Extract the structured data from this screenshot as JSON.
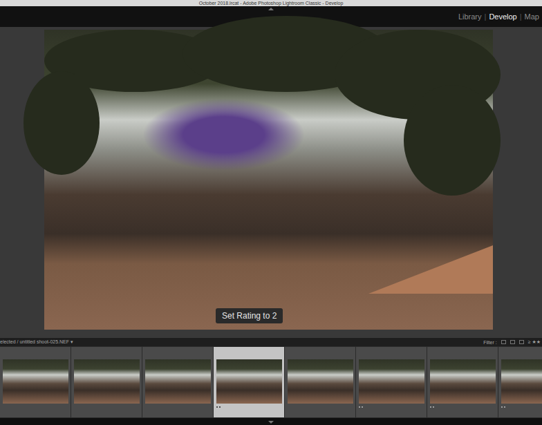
{
  "window": {
    "title": "October 2018.lrcat - Adobe Photoshop Lightroom Classic - Develop"
  },
  "modules": [
    {
      "label": "Library",
      "selected": false
    },
    {
      "label": "Develop",
      "selected": true
    },
    {
      "label": "Map",
      "selected": false
    }
  ],
  "module_separator": "|",
  "overlay": "Set Rating to 2",
  "filmstrip": {
    "source": "elected / untitled shoot-025.NEF ▾",
    "filter_label": "Filter :",
    "rating_filter": "≥ ★★",
    "thumbnails": [
      {
        "selected": false,
        "stars": 0
      },
      {
        "selected": false,
        "stars": 0
      },
      {
        "selected": false,
        "stars": 0
      },
      {
        "selected": true,
        "stars": 2
      },
      {
        "selected": false,
        "stars": 0
      },
      {
        "selected": false,
        "stars": 2
      },
      {
        "selected": false,
        "stars": 2
      },
      {
        "selected": false,
        "stars": 2
      }
    ]
  }
}
